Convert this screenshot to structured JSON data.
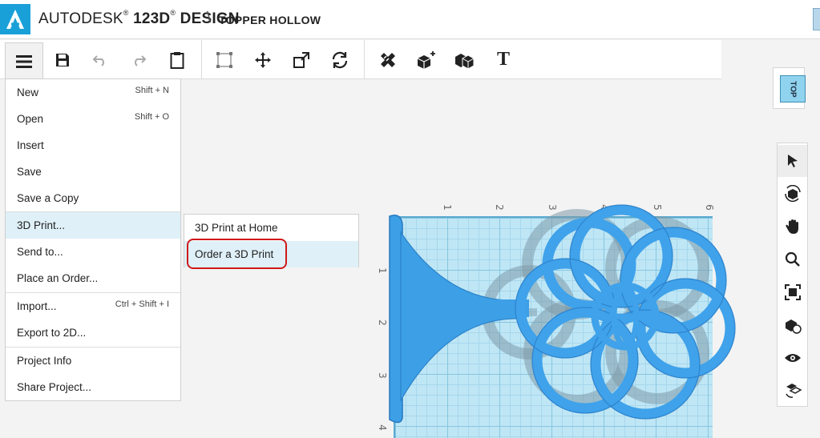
{
  "app": {
    "brand_prefix": "AUTODESK",
    "brand_reg": "®",
    "brand_product": "123D",
    "brand_sup": "®",
    "brand_suffix": "DESIGN",
    "separator": "\\",
    "project_name": "TOPPER HOLLOW"
  },
  "toolbar": {
    "items": [
      {
        "name": "menu",
        "icon": "hamburger-icon"
      },
      {
        "name": "save",
        "icon": "save-icon"
      },
      {
        "name": "undo",
        "icon": "undo-icon"
      },
      {
        "name": "redo",
        "icon": "redo-icon"
      },
      {
        "name": "paste",
        "icon": "clipboard-icon"
      },
      {
        "name": "smart-scale",
        "icon": "bounding-box-icon"
      },
      {
        "name": "move",
        "icon": "move-icon"
      },
      {
        "name": "scale",
        "icon": "scale-icon"
      },
      {
        "name": "rotate",
        "icon": "rotate-icon"
      },
      {
        "name": "measure",
        "icon": "measure-icon"
      },
      {
        "name": "primitives",
        "icon": "primitives-icon"
      },
      {
        "name": "combine",
        "icon": "combine-icon"
      },
      {
        "name": "text",
        "icon": "text-icon",
        "label": "T"
      }
    ]
  },
  "menu": {
    "items": [
      {
        "label": "New",
        "shortcut": "Shift + N"
      },
      {
        "label": "Open",
        "shortcut": "Shift + O"
      },
      {
        "label": "Insert",
        "shortcut": ""
      },
      {
        "label": "Save",
        "shortcut": ""
      },
      {
        "label": "Save a Copy",
        "shortcut": ""
      },
      {
        "label": "3D Print...",
        "shortcut": "",
        "active": true
      },
      {
        "label": "Send to...",
        "shortcut": ""
      },
      {
        "label": "Place an Order...",
        "shortcut": ""
      },
      {
        "label": "Import...",
        "shortcut": "Ctrl + Shift + I"
      },
      {
        "label": "Export to 2D...",
        "shortcut": ""
      },
      {
        "label": "Project Info",
        "shortcut": ""
      },
      {
        "label": "Share Project...",
        "shortcut": ""
      }
    ]
  },
  "submenu": {
    "items": [
      {
        "label": "3D Print at Home"
      },
      {
        "label": "Order a 3D Print",
        "active": true
      }
    ]
  },
  "viewcube": {
    "face": "TOP"
  },
  "ruler": {
    "top": [
      "1",
      "2",
      "3",
      "4",
      "5",
      "6"
    ],
    "left": [
      "1",
      "2",
      "3",
      "4"
    ]
  },
  "side_toolbar": {
    "items": [
      {
        "name": "select",
        "icon": "cursor-icon"
      },
      {
        "name": "orbit",
        "icon": "orbit-icon"
      },
      {
        "name": "pan",
        "icon": "hand-icon"
      },
      {
        "name": "zoom",
        "icon": "zoom-icon"
      },
      {
        "name": "fit",
        "icon": "fit-icon"
      },
      {
        "name": "material",
        "icon": "material-icon"
      },
      {
        "name": "visibility",
        "icon": "eye-icon"
      },
      {
        "name": "snap",
        "icon": "snap-icon"
      }
    ]
  },
  "colors": {
    "accent": "#1aa0d8",
    "model": "#3d9fe6",
    "grid": "#bfe6f5",
    "highlight": "#d01818"
  }
}
